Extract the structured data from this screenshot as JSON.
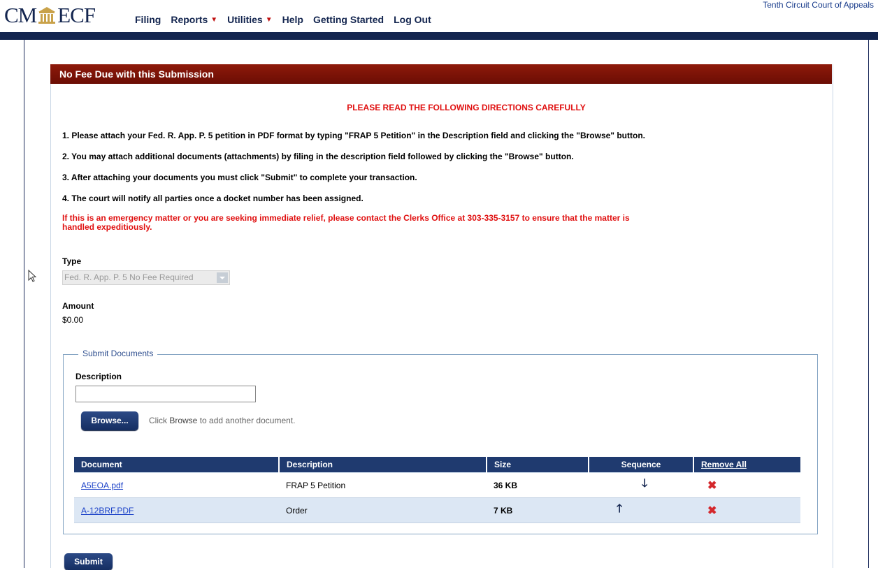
{
  "header": {
    "logo_left": "CM",
    "logo_right": "ECF",
    "court_name": "Tenth Circuit Court of Appeals",
    "nav": [
      {
        "label": "Filing",
        "has_menu": false
      },
      {
        "label": "Reports",
        "has_menu": true
      },
      {
        "label": "Utilities",
        "has_menu": true
      },
      {
        "label": "Help",
        "has_menu": false
      },
      {
        "label": "Getting Started",
        "has_menu": false
      },
      {
        "label": "Log Out",
        "has_menu": false
      }
    ]
  },
  "panel": {
    "title": "No Fee Due with this Submission",
    "warning_title": "PLEASE READ THE FOLLOWING DIRECTIONS CAREFULLY",
    "directions": [
      "1. Please attach your Fed. R. App. P. 5 petition in PDF format by typing \"FRAP 5 Petition\" in the Description field and clicking the \"Browse\" button.",
      "2. You may attach additional documents (attachments) by filing in the description field followed by clicking the \"Browse\" button.",
      "3. After attaching your documents you must click \"Submit\" to complete your transaction.",
      "4. The court will notify all parties once a docket number has been assigned."
    ],
    "emergency": "If this is an emergency matter or you are seeking immediate relief, please contact the Clerks Office at 303-335-3157 to ensure that the matter is handled expeditiously."
  },
  "form": {
    "type_label": "Type",
    "type_value": "Fed. R. App. P. 5 No Fee Required",
    "amount_label": "Amount",
    "amount_value": "$0.00"
  },
  "submit_docs": {
    "legend": "Submit Documents",
    "description_label": "Description",
    "description_value": "",
    "browse_label": "Browse...",
    "hint_prefix": "Click ",
    "hint_bold": "Browse",
    "hint_suffix": " to add another document."
  },
  "table": {
    "headers": {
      "document": "Document",
      "description": "Description",
      "size": "Size",
      "sequence": "Sequence",
      "remove_all": "Remove All"
    },
    "rows": [
      {
        "document": "A5EOA.pdf",
        "description": "FRAP 5 Petition",
        "size": "36 KB",
        "sequence": "down"
      },
      {
        "document": "A-12BRF.PDF",
        "description": "Order",
        "size": "7 KB",
        "sequence": "up"
      }
    ]
  },
  "icons": {
    "down": "arrow-down-icon",
    "up": "arrow-up-icon",
    "remove": "remove-x-icon"
  },
  "colors": {
    "navy": "#13254f",
    "header_red": "#7a1206",
    "warning_red": "#e01010",
    "link_blue": "#1d43c8"
  },
  "submit_label": "Submit"
}
